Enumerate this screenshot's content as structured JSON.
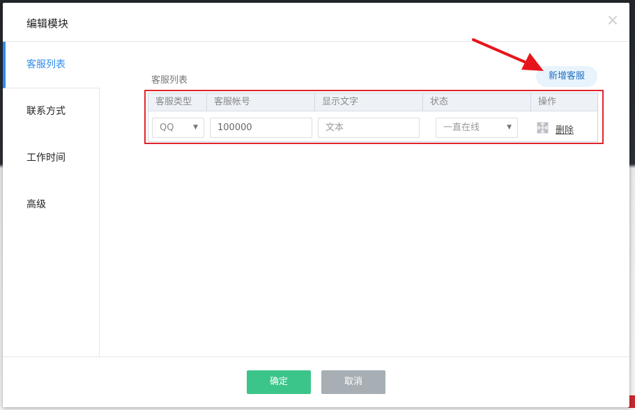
{
  "modal": {
    "title": "编辑模块",
    "close_glyph": "×"
  },
  "sidebar": {
    "items": [
      {
        "label": "客服列表",
        "active": true
      },
      {
        "label": "联系方式",
        "active": false
      },
      {
        "label": "工作时间",
        "active": false
      },
      {
        "label": "高级",
        "active": false
      }
    ]
  },
  "main": {
    "section_label": "客服列表",
    "add_button_label": "新增客服",
    "table": {
      "headers": [
        "客服类型",
        "客服帐号",
        "显示文字",
        "状态",
        "操作"
      ],
      "rows": [
        {
          "type": "QQ",
          "account": "100000",
          "display_text_placeholder": "文本",
          "status": "一直在线",
          "action_icon": "expand-icon",
          "delete_label": "删除"
        }
      ]
    }
  },
  "footer": {
    "ok_label": "确定",
    "cancel_label": "取消"
  },
  "colors": {
    "accent": "#2d8cf0",
    "ok_button": "#3cc58a",
    "cancel_button": "#a7afb4",
    "highlight": "#e0242a"
  }
}
